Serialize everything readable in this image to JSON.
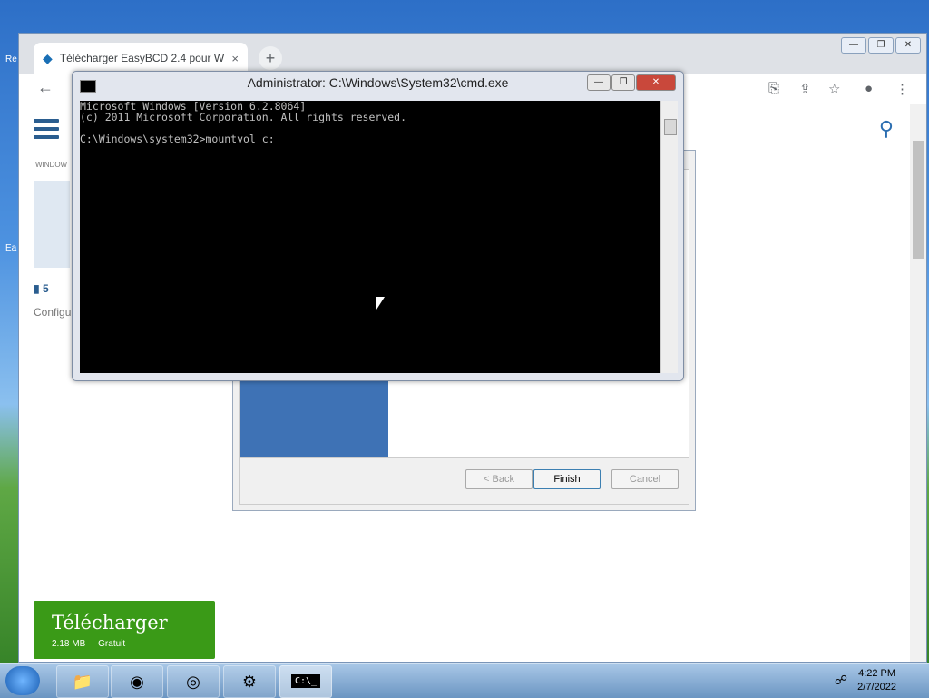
{
  "desktop": {
    "icon_labels": [
      "Re",
      "Ea"
    ]
  },
  "chrome": {
    "tab_title": "Télécharger EasyBCD 2.4 pour W",
    "tab_close": "×",
    "new_tab": "+",
    "window_buttons": [
      "—",
      "❐",
      "✕"
    ],
    "toolbar_icons": {
      "back": "←",
      "translate": "⎘",
      "share": "⇪",
      "star": "☆",
      "profile": "●",
      "menu": "⋮"
    }
  },
  "page": {
    "breadcrumb": "WINDOW",
    "comment_count": "5",
    "subtext": "Configu",
    "download": {
      "label": "Télécharger",
      "size": "2.18 MB",
      "license": "Gratuit"
    }
  },
  "wizard": {
    "back_label": "< Back",
    "finish_label": "Finish",
    "cancel_label": "Cancel"
  },
  "cmd": {
    "title": "Administrator: C:\\Windows\\System32\\cmd.exe",
    "lines": [
      "Microsoft Windows [Version 6.2.8064]",
      "(c) 2011 Microsoft Corporation. All rights reserved.",
      "",
      "C:\\Windows\\system32>mountvol c:"
    ],
    "buttons": [
      "—",
      "❐",
      "✕"
    ]
  },
  "taskbar": {
    "time": "4:22 PM",
    "date": "2/7/2022",
    "cmd_label": "C:\\_"
  }
}
